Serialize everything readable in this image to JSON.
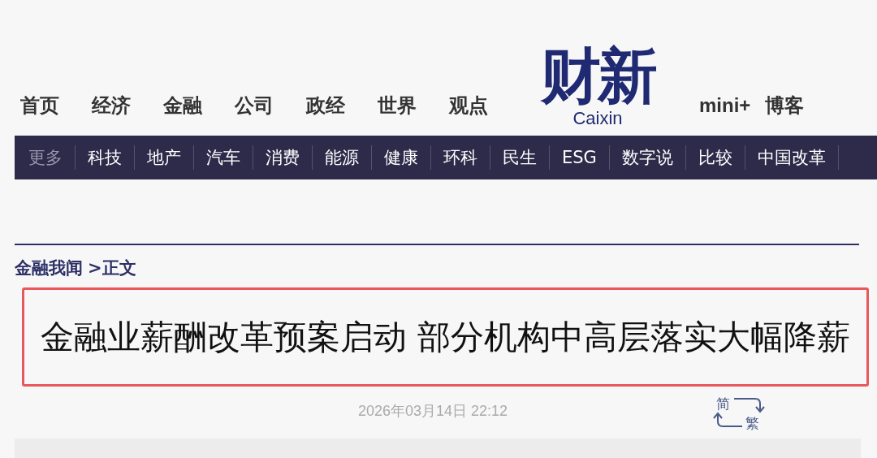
{
  "top_nav": [
    {
      "label": "首页"
    },
    {
      "label": "经济"
    },
    {
      "label": "金融"
    },
    {
      "label": "公司"
    },
    {
      "label": "政经"
    },
    {
      "label": "世界"
    },
    {
      "label": "观点"
    }
  ],
  "logo": {
    "name": "财新",
    "latin": "Caixin"
  },
  "top_nav_right": [
    {
      "label": "mini+"
    },
    {
      "label": "博客"
    }
  ],
  "channel_bar": [
    {
      "label": "更多",
      "kind": "label"
    },
    {
      "label": "科技",
      "kind": "link"
    },
    {
      "label": "地产",
      "kind": "link"
    },
    {
      "label": "汽车",
      "kind": "link"
    },
    {
      "label": "消费",
      "kind": "link"
    },
    {
      "label": "能源",
      "kind": "link"
    },
    {
      "label": "健康",
      "kind": "link"
    },
    {
      "label": "环科",
      "kind": "link"
    },
    {
      "label": "民生",
      "kind": "link"
    },
    {
      "label": "ESG",
      "kind": "link"
    },
    {
      "label": "数字说",
      "kind": "link"
    },
    {
      "label": "比较",
      "kind": "link"
    },
    {
      "label": "中国改革",
      "kind": "link"
    }
  ],
  "breadcrumb": {
    "section": "金融我闻",
    "current": ">正文"
  },
  "article": {
    "title": "金融业薪酬改革预案启动 部分机构中高层落实大幅降薪",
    "highlighted": true,
    "date": "2026年03月14日 22:12"
  },
  "script_toggle": {
    "simplified": "简",
    "traditional": "繁"
  }
}
